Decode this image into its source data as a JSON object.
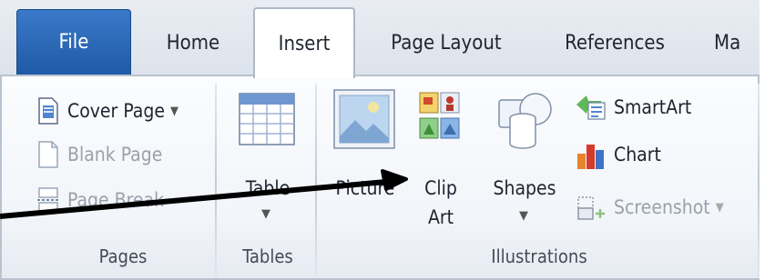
{
  "tabs": [
    {
      "label": "File"
    },
    {
      "label": "Home"
    },
    {
      "label": "Insert"
    },
    {
      "label": "Page Layout"
    },
    {
      "label": "References"
    },
    {
      "label": "Ma"
    }
  ],
  "groups": {
    "pages": {
      "label": "Pages",
      "items": [
        {
          "label": "Cover Page",
          "has_dropdown": true,
          "disabled": false
        },
        {
          "label": "Blank Page",
          "disabled": true
        },
        {
          "label": "Page Break",
          "disabled": true
        }
      ]
    },
    "tables": {
      "label": "Tables",
      "table_label": "Table"
    },
    "illustrations": {
      "label": "Illustrations",
      "picture_label": "Picture",
      "clipart_label_1": "Clip",
      "clipart_label_2": "Art",
      "shapes_label": "Shapes",
      "smartart_label": "SmartArt",
      "chart_label": "Chart",
      "screenshot_label": "Screenshot"
    }
  },
  "colors": {
    "file_tab": "#2a66b6",
    "ribbon_bg": "#f5f7fa",
    "arrow": "#000000"
  }
}
